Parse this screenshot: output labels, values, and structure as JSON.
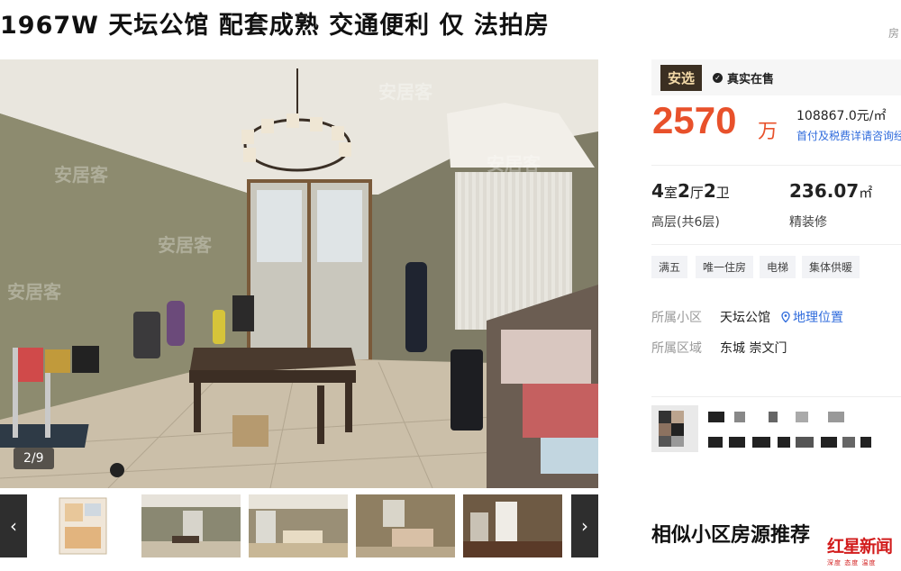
{
  "listing": {
    "title": "1967W 天坛公馆 配套成熟 交通便利 仅 法拍房",
    "corner_tag": "房"
  },
  "gallery": {
    "counter": "2/9",
    "watermark": "安居客",
    "prev_arrow": "‹",
    "next_arrow": "›"
  },
  "badges": {
    "anxuan": "安选",
    "real_listing": "真实在售"
  },
  "price": {
    "total": "2570",
    "total_unit": "万",
    "unit_price": "108867.0元/㎡",
    "tax_link": "首付及税费详请咨询经"
  },
  "specs": {
    "room_num_1": "4",
    "room_unit_1": "室",
    "room_num_2": "2",
    "room_unit_2": "厅",
    "room_num_3": "2",
    "room_unit_3": "卫",
    "floor": "高层(共6层)",
    "area": "236.07",
    "area_unit": "㎡",
    "decoration": "精装修"
  },
  "tags": [
    "满五",
    "唯一住房",
    "电梯",
    "集体供暖"
  ],
  "location": {
    "community_label": "所属小区",
    "community": "天坛公馆",
    "geo_link": "地理位置",
    "district_label": "所属区域",
    "district": "东城 崇文门"
  },
  "similar": {
    "heading": "相似小区房源推荐"
  },
  "logo": {
    "main": "红星新闻",
    "sub": "深度 态度 温度"
  },
  "colors": {
    "price": "#e8512b",
    "link": "#2f6bdc",
    "badge_bg": "#3b2f22",
    "badge_text": "#f3d9a7",
    "logo": "#d21c1c"
  }
}
